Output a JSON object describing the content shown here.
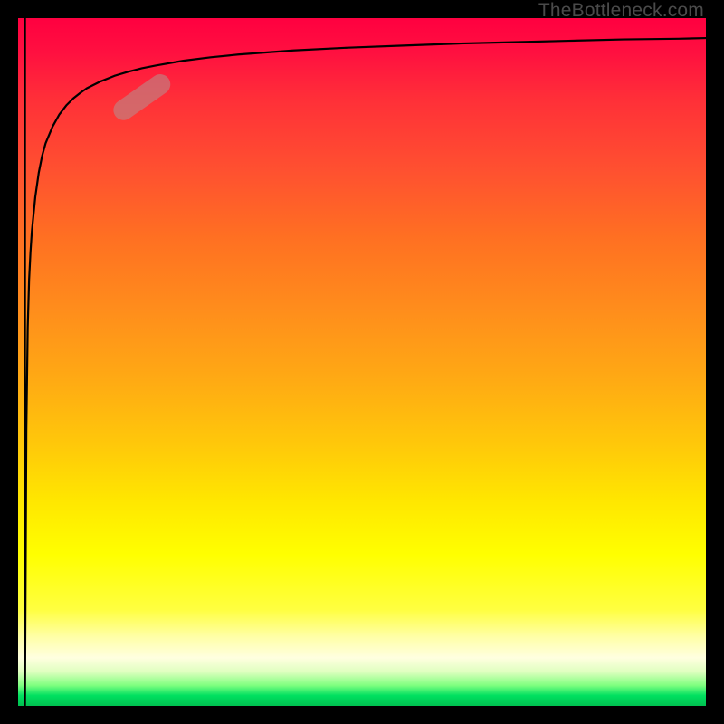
{
  "watermark": "TheBottleneck.com",
  "colors": {
    "frame": "#000000",
    "curve": "#000000",
    "capsule_fill": "#bb8888",
    "capsule_fill_opacity": 0.62
  },
  "chart_data": {
    "type": "line",
    "title": "",
    "xlabel": "",
    "ylabel": "",
    "xlim": [
      0,
      100
    ],
    "ylim": [
      0,
      100
    ],
    "grid": false,
    "x": [
      1.0,
      1.2,
      1.4,
      1.6,
      1.8,
      2.0,
      2.5,
      3.0,
      3.5,
      4.0,
      5.0,
      6.0,
      7.0,
      8.0,
      9.0,
      10.0,
      12.0,
      14.0,
      16.0,
      18.0,
      20.0,
      24.0,
      28.0,
      32.0,
      36.0,
      40.0,
      48.0,
      56.0,
      64.0,
      72.0,
      80.0,
      88.0,
      96.0,
      100.0
    ],
    "y": [
      0.0,
      40.0,
      55.0,
      62.0,
      66.0,
      69.0,
      74.0,
      77.5,
      80.0,
      81.8,
      84.2,
      86.0,
      87.3,
      88.3,
      89.1,
      89.8,
      90.8,
      91.6,
      92.2,
      92.7,
      93.1,
      93.8,
      94.3,
      94.7,
      95.0,
      95.3,
      95.7,
      96.0,
      96.3,
      96.5,
      96.7,
      96.9,
      97.0,
      97.1
    ],
    "spike": {
      "at_x": 1.0,
      "to_y": 100.0
    },
    "marker": {
      "shape": "capsule",
      "center_x": 18.0,
      "center_y": 88.5,
      "half_len": 4.5,
      "half_wid": 1.4,
      "tangent_dx": 1.0,
      "tangent_dy": 0.7
    }
  }
}
